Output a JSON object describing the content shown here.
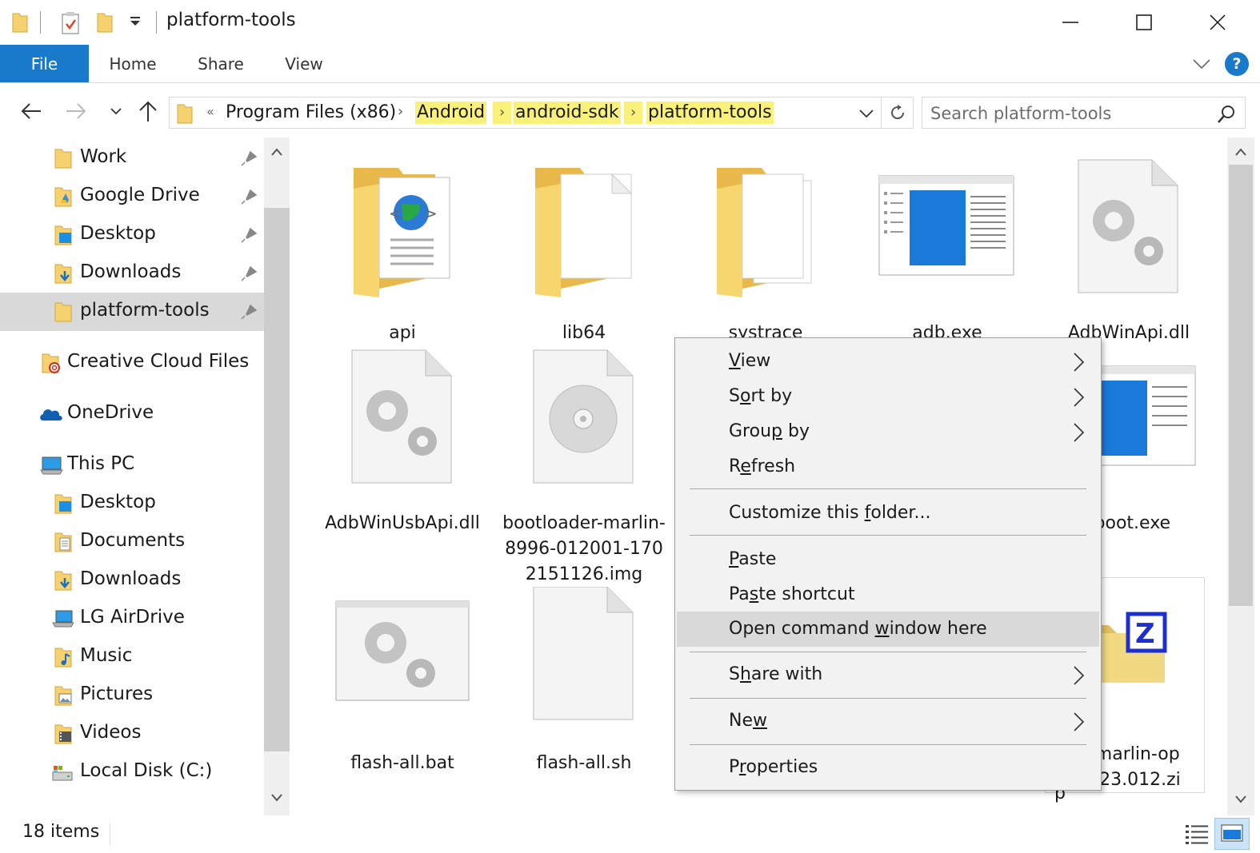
{
  "window": {
    "title": "platform-tools"
  },
  "ribbon": {
    "tabs": [
      {
        "id": "file",
        "label": "File"
      },
      {
        "id": "home",
        "label": "Home"
      },
      {
        "id": "share",
        "label": "Share"
      },
      {
        "id": "view",
        "label": "View"
      }
    ],
    "help_label": "?"
  },
  "address": {
    "overflow": "«",
    "crumbs": [
      "Program Files (x86)",
      "Android",
      "android-sdk",
      "platform-tools"
    ],
    "highlighted": [
      "Android",
      "android-sdk",
      "platform-tools"
    ]
  },
  "search": {
    "placeholder": "Search platform-tools"
  },
  "navpane": {
    "quick_access": [
      {
        "label": "Work",
        "icon": "folder-icon"
      },
      {
        "label": "Google Drive",
        "icon": "google-drive-folder-icon"
      },
      {
        "label": "Desktop",
        "icon": "desktop-folder-icon"
      },
      {
        "label": "Downloads",
        "icon": "downloads-folder-icon"
      },
      {
        "label": "platform-tools",
        "icon": "folder-icon"
      }
    ],
    "creative_cloud": "Creative Cloud Files",
    "onedrive": "OneDrive",
    "this_pc": "This PC",
    "pc_items": [
      {
        "label": "Desktop",
        "icon": "desktop-folder-icon"
      },
      {
        "label": "Documents",
        "icon": "documents-folder-icon"
      },
      {
        "label": "Downloads",
        "icon": "downloads-folder-icon"
      },
      {
        "label": "LG AirDrive",
        "icon": "lg-airdrive-icon"
      },
      {
        "label": "Music",
        "icon": "music-folder-icon"
      },
      {
        "label": "Pictures",
        "icon": "pictures-folder-icon"
      },
      {
        "label": "Videos",
        "icon": "videos-folder-icon"
      },
      {
        "label": "Local Disk (C:)",
        "icon": "local-disk-icon"
      }
    ]
  },
  "files": [
    {
      "name": "api",
      "icon": "folder-api-icon"
    },
    {
      "name": "lib64",
      "icon": "folder-lib-icon"
    },
    {
      "name": "systrace",
      "icon": "folder-systrace-icon"
    },
    {
      "name": "adb.exe",
      "icon": "exe-window-icon"
    },
    {
      "name": "AdbWinApi.dll",
      "icon": "dll-gears-icon"
    },
    {
      "name": "AdbWinUsbApi.dll",
      "icon": "dll-gears-icon"
    },
    {
      "name": "bootloader-marlin-8996-012001-1702151126.img",
      "icon": "disc-image-icon"
    },
    {
      "name": "tboot.exe",
      "icon": "exe-window-icon"
    },
    {
      "name": "flash-all.bat",
      "icon": "batch-gears-icon"
    },
    {
      "name": "flash-all.sh",
      "icon": "blank-file-icon"
    },
    {
      "name": "e-marlin-op",
      "icon": "zip-archive-icon"
    }
  ],
  "partial_labels": {
    "zip_line2": "0223.012.zi",
    "zip_line3": "p"
  },
  "context_menu": {
    "items": [
      {
        "label": "View",
        "accel": "V",
        "submenu": true
      },
      {
        "label": "Sort by",
        "accel": "o",
        "submenu": true
      },
      {
        "label": "Group by",
        "accel": "p",
        "submenu": true
      },
      {
        "label": "Refresh",
        "accel": "e",
        "submenu": false
      },
      {
        "label": "Customize this folder...",
        "accel": "f",
        "submenu": false
      },
      {
        "label": "Paste",
        "accel": "P",
        "submenu": false
      },
      {
        "label": "Paste shortcut",
        "accel": "s",
        "submenu": false
      },
      {
        "label": "Open command window here",
        "accel": "w",
        "submenu": false,
        "hover": true
      },
      {
        "label": "Share with",
        "accel": "h",
        "submenu": true
      },
      {
        "label": "New",
        "accel": "w",
        "submenu": true
      },
      {
        "label": "Properties",
        "accel": "r",
        "submenu": false
      }
    ]
  },
  "status": {
    "item_count": "18 items"
  },
  "colors": {
    "accent": "#1979ca",
    "highlight": "#f9f17a",
    "selection": "#d9d9d9",
    "folder": "#f5d170"
  }
}
